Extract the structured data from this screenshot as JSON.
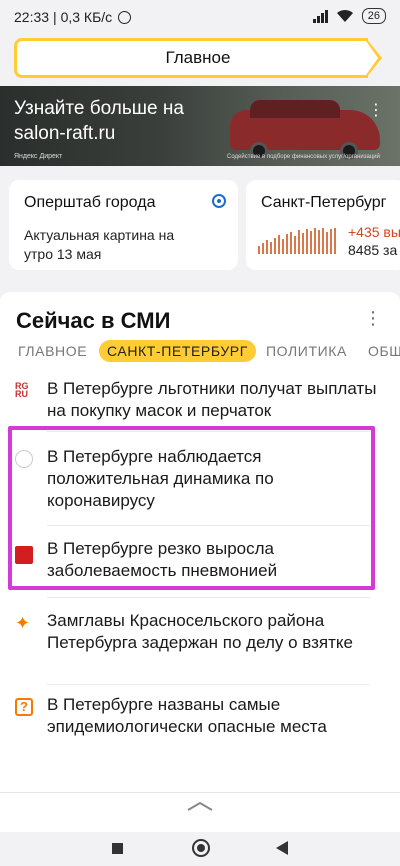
{
  "status_bar": {
    "time": "22:33",
    "network_speed": "| 0,3 КБ/с",
    "battery": "26"
  },
  "search": {
    "label": "Главное"
  },
  "ad": {
    "title": "Узнайте больше на salon-raft.ru",
    "source": "Яндекс Директ",
    "note": "Содействие в подборе финансовых услуг/организаций",
    "menu_icon": "more-vertical-icon"
  },
  "cards": [
    {
      "title": "Оперштаб города",
      "text": "Актуальная картина на утро 13 мая",
      "icon": "location-icon"
    },
    {
      "title": "Санкт-Петербург",
      "stat_primary": "+435 вы",
      "stat_secondary": "8485 за",
      "accent": "#d0471d"
    }
  ],
  "news": {
    "title": "Сейчас в СМИ",
    "tabs": [
      "ГЛАВНОЕ",
      "САНКТ-ПЕТЕРБУРГ",
      "ПОЛИТИКА",
      "ОБЩ"
    ],
    "active_tab": "САНКТ-ПЕТЕРБУРГ",
    "items": [
      {
        "icon": "rg-ru-logo-icon",
        "logo_text": "RG RU",
        "text": "В Петербурге льготники получат выплаты на покупку масок и перчаток"
      },
      {
        "icon": "news-source-circle-icon",
        "text": "В Петербурге наблюдается положительная динамика по коронавирусу"
      },
      {
        "icon": "news-source-red-icon",
        "text": "В Петербурге резко выросла заболеваемость пневмонией"
      },
      {
        "icon": "flame-icon",
        "text": "Замглавы Красносельского района Петербурга задержан по делу о взятке"
      },
      {
        "icon": "question-box-icon",
        "text": "В Петербурге названы самые эпидемиологически опасные места"
      }
    ]
  },
  "colors": {
    "accent_yellow": "#ffcc33",
    "highlight": "#d43ad6"
  }
}
